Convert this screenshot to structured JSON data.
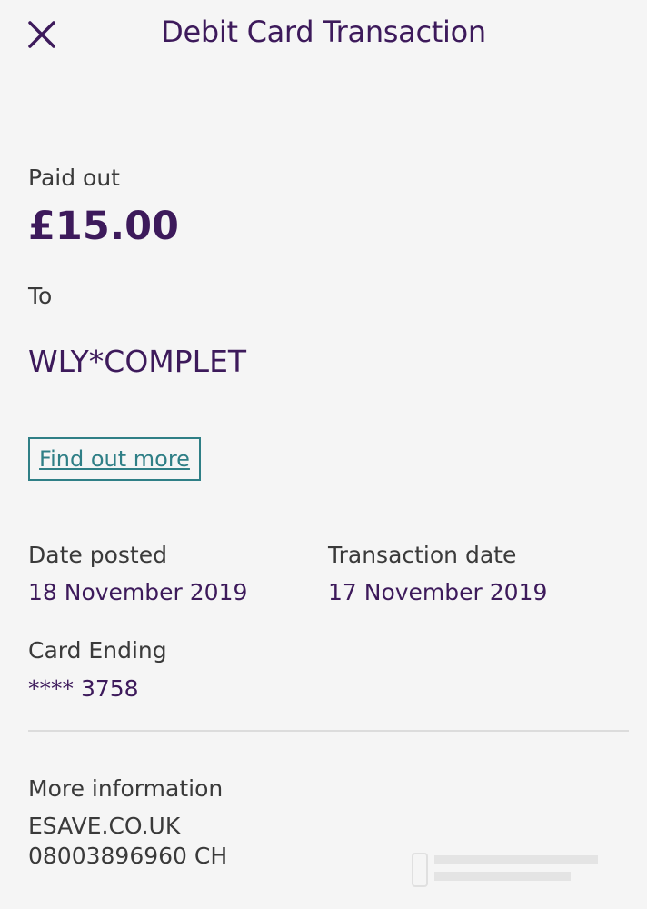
{
  "header": {
    "title": "Debit Card Transaction",
    "close_icon": "close-icon"
  },
  "transaction": {
    "paid_out_label": "Paid out",
    "amount": "£15.00",
    "to_label": "To",
    "payee": "WLY*COMPLET",
    "find_out_more": "Find out more"
  },
  "details": {
    "date_posted_label": "Date posted",
    "date_posted": "18 November 2019",
    "transaction_date_label": "Transaction date",
    "transaction_date": "17 November 2019",
    "card_ending_label": "Card Ending",
    "card_ending": "**** 3758"
  },
  "more_info": {
    "label": "More information",
    "line1": "ESAVE.CO.UK",
    "line2": "08003896960 CH"
  },
  "colors": {
    "brand_purple": "#3d1a5b",
    "link_teal": "#2f7f86",
    "background": "#f5f5f5"
  }
}
